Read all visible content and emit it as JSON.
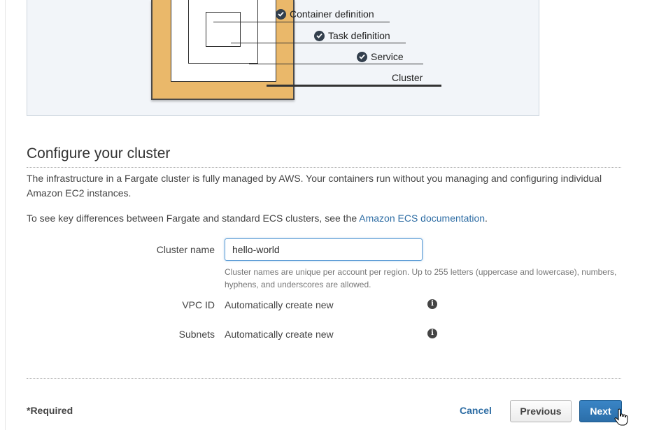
{
  "diagram": {
    "labels": {
      "container": "Container definition",
      "task": "Task definition",
      "service": "Service",
      "cluster": "Cluster"
    },
    "colors": {
      "cluster_fill": "#eab86a",
      "check_icon": "#333f4d"
    }
  },
  "configure": {
    "title": "Configure your cluster",
    "intro": "The infrastructure in a Fargate cluster is fully managed by AWS. Your containers run without you managing and configuring individual Amazon EC2 instances.",
    "differences_prefix": "To see key differences between Fargate and standard ECS clusters, see the ",
    "differences_link": "Amazon ECS documentation",
    "differences_suffix": ".",
    "cluster_name": {
      "label": "Cluster name",
      "value": "hello-world",
      "help": "Cluster names are unique per account per region. Up to 255 letters (uppercase and lowercase), numbers, hyphens, and underscores are allowed."
    },
    "vpc_id": {
      "label": "VPC ID",
      "value": "Automatically create new",
      "info_icon": "info-icon"
    },
    "subnets": {
      "label": "Subnets",
      "value": "Automatically create new",
      "info_icon": "info-icon"
    }
  },
  "footer": {
    "required": "*Required",
    "cancel": "Cancel",
    "previous": "Previous",
    "next": "Next"
  },
  "colors": {
    "link": "#2e6da4",
    "primary_button": "#2b6ea9"
  }
}
